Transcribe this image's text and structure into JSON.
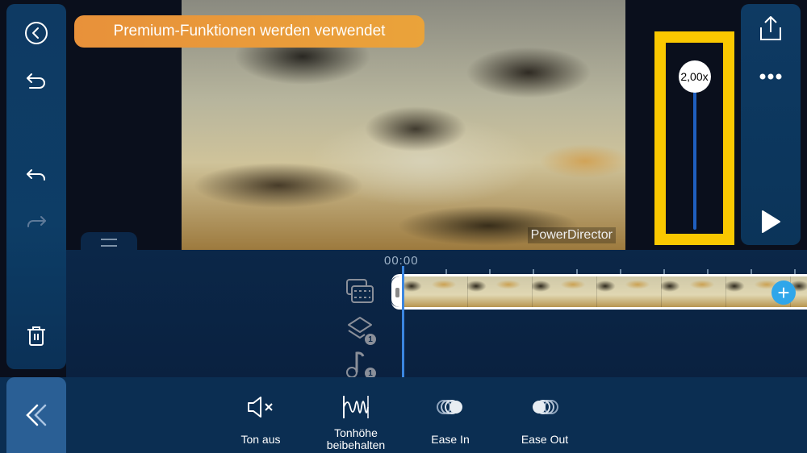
{
  "banner": {
    "text": "Premium-Funktionen werden verwendet",
    "color": "#e8913a"
  },
  "preview": {
    "watermark": "PowerDirector"
  },
  "left_panel": {
    "icons": [
      "back-icon",
      "revert-icon",
      "undo-icon",
      "redo-icon",
      "delete-icon"
    ]
  },
  "speed": {
    "value_label": "2,00x",
    "value": 2.0,
    "highlight_color": "#fac800"
  },
  "right_panel": {
    "icons": [
      "export-icon",
      "more-icon",
      "play-icon"
    ]
  },
  "timeline": {
    "timecode": "00:00",
    "tracks": [
      {
        "name": "video-track",
        "badge": ""
      },
      {
        "name": "overlay-track",
        "badge": "1"
      },
      {
        "name": "audio-track",
        "badge": "1"
      }
    ]
  },
  "toolbar": {
    "items": [
      {
        "id": "mute",
        "label": "Ton aus"
      },
      {
        "id": "keep-pitch",
        "label": "Tonhöhe beibehalten"
      },
      {
        "id": "ease-in",
        "label": "Ease In"
      },
      {
        "id": "ease-out",
        "label": "Ease Out"
      }
    ]
  },
  "colors": {
    "accent": "#3b86e0",
    "add_button": "#2fa6ea",
    "panel": "#0e3a63"
  }
}
